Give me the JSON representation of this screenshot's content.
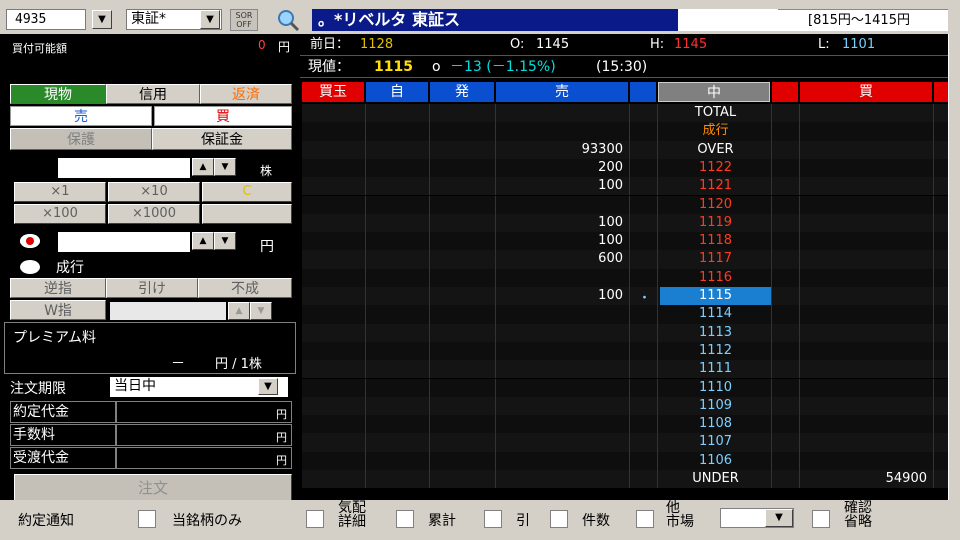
{
  "toolbar": {
    "code": "4935",
    "market": "東証*",
    "sor": "SOR OFF",
    "title": "。*リベルタ 東証ス",
    "range": "[815円〜1415円"
  },
  "order": {
    "buyable_label": "買付可能額",
    "buyable_value": "0",
    "buyable_unit": "円",
    "tabs": [
      "現物",
      "信用",
      "返済"
    ],
    "sell": "売",
    "buy": "買",
    "hoshou_left": "保護",
    "hoshou_right": "保証金",
    "qty_unit": "株",
    "mult_buttons": [
      "×1",
      "×10",
      "C",
      "×100",
      "×1000",
      ""
    ],
    "price_unit": "円",
    "market_order": "成行",
    "cond_buttons": [
      "逆指",
      "引け",
      "不成"
    ],
    "w_label": "W指",
    "premium_label": "プレミアム料",
    "premium_value": "－",
    "premium_unit": "円 / 1株",
    "period_label": "注文期限",
    "period_value": "当日中",
    "cost_rows": [
      {
        "label": "約定代金",
        "unit": "円"
      },
      {
        "label": "手数料",
        "unit": "円"
      },
      {
        "label": "受渡代金",
        "unit": "円"
      }
    ],
    "submit": "注文"
  },
  "board": {
    "prev_label": "前日：",
    "prev_value": "1128",
    "open_label": "O: ",
    "open_value": "1145",
    "high_label": "H: ",
    "high_value": "1145",
    "low_label": "L: ",
    "low_value": "1101",
    "current_label": "現値：",
    "current_value": "1115",
    "current_mark": "o",
    "change": "－13 (－1.15%)",
    "time": "(15:30)",
    "headers": [
      "買玉",
      "自",
      "発",
      "売",
      "中",
      "買"
    ],
    "rows": [
      {
        "sell": "",
        "price": "TOTAL",
        "buy": "",
        "pcolor": "#ffffff"
      },
      {
        "sell": "",
        "price": "成行",
        "buy": "",
        "pcolor": "#ff8c00"
      },
      {
        "sell": "93300",
        "price": "OVER",
        "buy": "",
        "pcolor": "#ffffff"
      },
      {
        "sell": "200",
        "price": "1122",
        "buy": "",
        "pcolor": "#ff3b1f"
      },
      {
        "sell": "100",
        "price": "1121",
        "buy": "",
        "pcolor": "#ff3b1f"
      },
      {
        "sell": "",
        "price": "1120",
        "buy": "",
        "pcolor": "#ff3b1f"
      },
      {
        "sell": "100",
        "price": "1119",
        "buy": "",
        "pcolor": "#ff3b1f"
      },
      {
        "sell": "100",
        "price": "1118",
        "buy": "",
        "pcolor": "#ff3b1f"
      },
      {
        "sell": "600",
        "price": "1117",
        "buy": "",
        "pcolor": "#ff3b1f"
      },
      {
        "sell": "",
        "price": "1116",
        "buy": "",
        "pcolor": "#ff3b1f"
      },
      {
        "sell": "100",
        "price": "1115",
        "buy": "",
        "pcolor": "#ffffff",
        "mark": "・"
      },
      {
        "sell": "",
        "price": "1114",
        "buy": "",
        "pcolor": "#7ad0ff"
      },
      {
        "sell": "",
        "price": "1113",
        "buy": "",
        "pcolor": "#7ad0ff"
      },
      {
        "sell": "",
        "price": "1112",
        "buy": "",
        "pcolor": "#7ad0ff"
      },
      {
        "sell": "",
        "price": "1111",
        "buy": "",
        "pcolor": "#7ad0ff"
      },
      {
        "sell": "",
        "price": "1110",
        "buy": "",
        "pcolor": "#7ad0ff"
      },
      {
        "sell": "",
        "price": "1109",
        "buy": "",
        "pcolor": "#7ad0ff"
      },
      {
        "sell": "",
        "price": "1108",
        "buy": "",
        "pcolor": "#7ad0ff"
      },
      {
        "sell": "",
        "price": "1107",
        "buy": "",
        "pcolor": "#7ad0ff"
      },
      {
        "sell": "",
        "price": "1106",
        "buy": "",
        "pcolor": "#7ad0ff"
      },
      {
        "sell": "",
        "price": "UNDER",
        "buy": "54900",
        "pcolor": "#ffffff"
      }
    ]
  },
  "bottom": {
    "notify": "約定通知",
    "only_this": "当銘柄のみ",
    "detail": "気配\n詳細",
    "cumulative": "累計",
    "pull": "引",
    "count": "件数",
    "other_market": "他\n市場",
    "confirm_skip": "確認\n省略"
  },
  "colors": {
    "title_bg": "#0a1a88",
    "header_red": "#e00000",
    "header_blue": "#0a4fd0",
    "highlight": "#1a7fd0",
    "tab_green": "#2a8a2a"
  }
}
